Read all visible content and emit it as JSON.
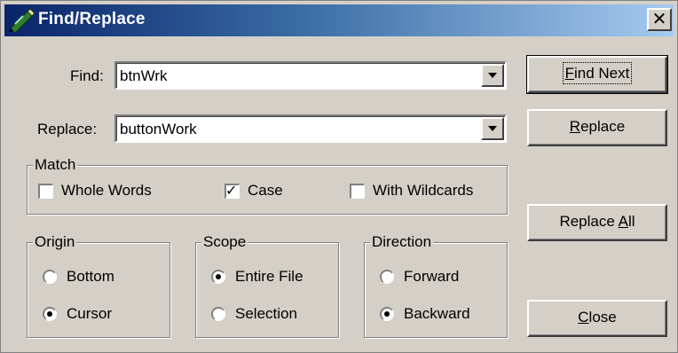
{
  "window": {
    "title": "Find/Replace",
    "close_glyph": "✕",
    "icon": "pencil-icon"
  },
  "find": {
    "label": "Find:",
    "value": "btnWrk"
  },
  "replace": {
    "label": "Replace:",
    "value": "buttonWork"
  },
  "match": {
    "legend": "Match",
    "options": [
      {
        "label": "Whole Words",
        "checked": false
      },
      {
        "label": "Case",
        "checked": true
      },
      {
        "label": "With Wildcards",
        "checked": false
      }
    ]
  },
  "origin": {
    "legend": "Origin",
    "options": [
      {
        "label": "Bottom",
        "selected": false
      },
      {
        "label": "Cursor",
        "selected": true
      }
    ]
  },
  "scope": {
    "legend": "Scope",
    "options": [
      {
        "label": "Entire File",
        "selected": true
      },
      {
        "label": "Selection",
        "selected": false
      }
    ]
  },
  "direction": {
    "legend": "Direction",
    "options": [
      {
        "label": "Forward",
        "selected": false
      },
      {
        "label": "Backward",
        "selected": true
      }
    ]
  },
  "buttons": {
    "find_next": {
      "mnemonic": "F",
      "rest": "ind Next"
    },
    "replace": {
      "mnemonic": "R",
      "rest": "eplace"
    },
    "replace_all": {
      "prefix": "Replace ",
      "mnemonic": "A",
      "rest": "ll"
    },
    "close": {
      "mnemonic": "C",
      "rest": "lose"
    }
  },
  "colors": {
    "dialog_face": "#d4d0c8",
    "title_start": "#0a246a",
    "title_end": "#a6caf0"
  }
}
